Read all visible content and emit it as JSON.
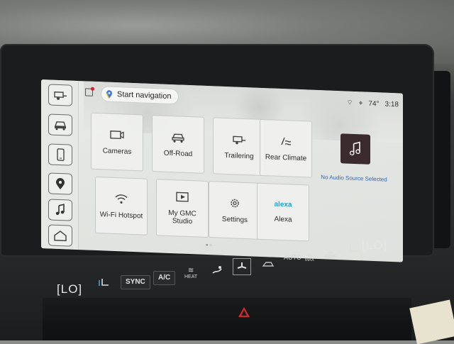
{
  "navigation": {
    "label": "Start navigation"
  },
  "status": {
    "temp": "74°",
    "time": "3:18"
  },
  "tiles": [
    {
      "label": "Cameras",
      "icon": "camera-icon"
    },
    {
      "label": "Off-Road",
      "icon": "offroad-truck-icon"
    },
    {
      "label": "Trailering",
      "icon": "trailer-icon"
    },
    {
      "label": "Rear Climate",
      "icon": "rear-climate-icon"
    },
    {
      "label": "Wi-Fi Hotspot",
      "icon": "wifi-icon"
    },
    {
      "label": "My GMC Studio",
      "icon": "play-icon"
    },
    {
      "label": "Settings",
      "icon": "gear-icon"
    },
    {
      "label": "Alexa",
      "icon": "alexa-logo"
    }
  ],
  "alexa_logo_text": "alexa",
  "audio": {
    "status": "No Audio Source Selected"
  },
  "rail": [
    "trailer-icon",
    "truck-icon",
    "phone-icon",
    "location-pin-icon",
    "music-note-icon",
    "home-icon"
  ],
  "climate": {
    "left_temp": "LO",
    "right_temp": "LO",
    "sync_label": "SYNC",
    "ac_label": "A/C",
    "heat_label": "HEAT",
    "auto_label": "AUTO",
    "max_label": "MAX",
    "rear_label": "REAR"
  }
}
